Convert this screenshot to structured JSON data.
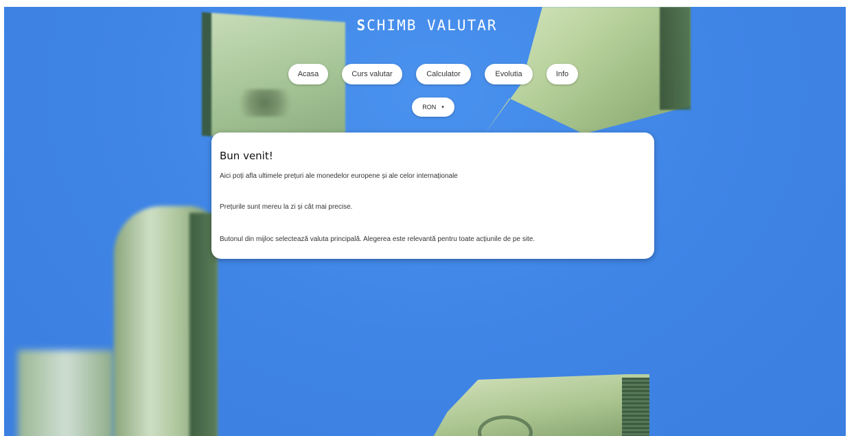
{
  "header": {
    "title_first": "S",
    "title_rest": "CHIMB VALUTAR"
  },
  "nav": {
    "items": [
      {
        "label": "Acasa"
      },
      {
        "label": "Curs valutar"
      },
      {
        "label": "Calculator"
      },
      {
        "label": "Evolutia"
      },
      {
        "label": "Info"
      }
    ]
  },
  "currency": {
    "selected": "RON",
    "arrow": "▾"
  },
  "welcome": {
    "heading": "Bun venit!",
    "paragraphs": [
      "Aici poți afla ultimele prețuri ale monedelor europene și ale celor internaționale",
      "Prețurile sunt mereu la zi și cât mai precise.",
      "Butonul din mijloc selectează valuta principală. Alegerea este relevantă pentru toate acțiunile de pe site."
    ]
  },
  "colors": {
    "background": "#3f85e6",
    "card": "#ffffff",
    "money_green": "#b9d29d"
  }
}
